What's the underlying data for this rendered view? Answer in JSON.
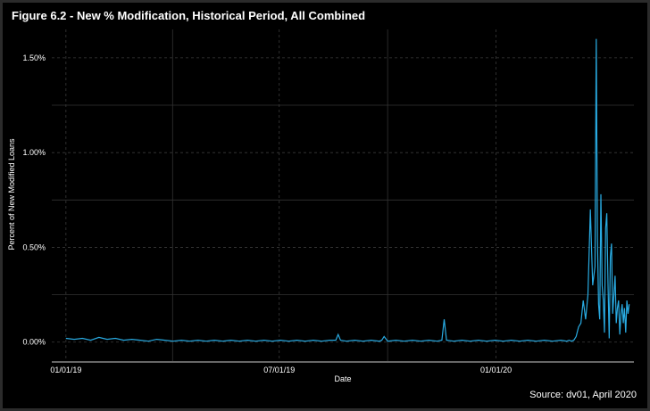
{
  "chart_data": {
    "type": "line",
    "title": "Figure 6.2 - New % Modification, Historical Period, All Combined",
    "xlabel": "Date",
    "ylabel": "Percent of New Modified Loans",
    "source": "Source: dv01, April 2020",
    "x_tick_labels": [
      "01/01/19",
      "07/01/19",
      "01/01/20"
    ],
    "x_ticks": [
      "2019-01-01",
      "2019-07-01",
      "2020-01-01"
    ],
    "y_tick_labels": [
      "0.00%",
      "0.50%",
      "1.00%",
      "1.50%"
    ],
    "y_ticks": [
      0.0,
      0.5,
      1.0,
      1.5
    ],
    "xlim": [
      "2018-12-20",
      "2020-04-27"
    ],
    "ylim": [
      -0.1,
      1.65
    ],
    "line_color": "#29abe2",
    "grid": true,
    "series": [
      {
        "x": [
          "2019-01-01",
          "2019-01-08",
          "2019-01-15",
          "2019-01-22",
          "2019-01-29",
          "2019-02-05",
          "2019-02-12",
          "2019-02-19",
          "2019-02-26",
          "2019-03-05",
          "2019-03-12",
          "2019-03-19",
          "2019-03-26",
          "2019-04-02",
          "2019-04-09",
          "2019-04-16",
          "2019-04-23",
          "2019-04-30",
          "2019-05-07",
          "2019-05-14",
          "2019-05-21",
          "2019-05-28",
          "2019-06-04",
          "2019-06-11",
          "2019-06-18",
          "2019-06-25",
          "2019-07-02",
          "2019-07-09",
          "2019-07-16",
          "2019-07-23",
          "2019-07-30",
          "2019-08-06",
          "2019-08-13",
          "2019-08-18",
          "2019-08-20",
          "2019-08-22",
          "2019-08-27",
          "2019-09-03",
          "2019-09-10",
          "2019-09-17",
          "2019-09-24",
          "2019-09-26",
          "2019-09-28",
          "2019-10-01",
          "2019-10-08",
          "2019-10-15",
          "2019-10-22",
          "2019-10-29",
          "2019-11-05",
          "2019-11-12",
          "2019-11-16",
          "2019-11-18",
          "2019-11-20",
          "2019-11-26",
          "2019-12-03",
          "2019-12-10",
          "2019-12-17",
          "2019-12-24",
          "2019-12-31",
          "2020-01-07",
          "2020-01-14",
          "2020-01-21",
          "2020-01-28",
          "2020-02-04",
          "2020-02-11",
          "2020-02-18",
          "2020-02-25",
          "2020-03-01",
          "2020-03-03",
          "2020-03-05",
          "2020-03-07",
          "2020-03-09",
          "2020-03-11",
          "2020-03-13",
          "2020-03-15",
          "2020-03-17",
          "2020-03-19",
          "2020-03-21",
          "2020-03-23",
          "2020-03-25",
          "2020-03-26",
          "2020-03-27",
          "2020-03-28",
          "2020-03-29",
          "2020-03-30",
          "2020-03-31",
          "2020-04-01",
          "2020-04-02",
          "2020-04-03",
          "2020-04-04",
          "2020-04-05",
          "2020-04-06",
          "2020-04-07",
          "2020-04-08",
          "2020-04-09",
          "2020-04-10",
          "2020-04-11",
          "2020-04-12",
          "2020-04-13",
          "2020-04-14",
          "2020-04-15",
          "2020-04-16",
          "2020-04-17",
          "2020-04-18",
          "2020-04-19",
          "2020-04-20",
          "2020-04-21",
          "2020-04-22",
          "2020-04-23"
        ],
        "values": [
          0.02,
          0.015,
          0.02,
          0.01,
          0.025,
          0.015,
          0.02,
          0.01,
          0.015,
          0.01,
          0.005,
          0.015,
          0.01,
          0.005,
          0.01,
          0.005,
          0.01,
          0.005,
          0.01,
          0.005,
          0.01,
          0.005,
          0.01,
          0.005,
          0.01,
          0.005,
          0.01,
          0.005,
          0.01,
          0.005,
          0.01,
          0.005,
          0.01,
          0.01,
          0.04,
          0.01,
          0.005,
          0.01,
          0.005,
          0.01,
          0.005,
          0.01,
          0.03,
          0.005,
          0.01,
          0.005,
          0.01,
          0.005,
          0.01,
          0.005,
          0.01,
          0.12,
          0.01,
          0.005,
          0.01,
          0.005,
          0.01,
          0.005,
          0.01,
          0.005,
          0.01,
          0.005,
          0.01,
          0.005,
          0.01,
          0.005,
          0.01,
          0.005,
          0.01,
          0.005,
          0.01,
          0.03,
          0.08,
          0.1,
          0.22,
          0.12,
          0.25,
          0.7,
          0.3,
          0.4,
          1.6,
          0.55,
          0.2,
          0.12,
          0.78,
          0.3,
          0.22,
          0.05,
          0.6,
          0.68,
          0.3,
          0.02,
          0.45,
          0.52,
          0.15,
          0.25,
          0.35,
          0.1,
          0.18,
          0.22,
          0.04,
          0.15,
          0.2,
          0.1,
          0.18,
          0.05,
          0.22,
          0.15,
          0.2
        ]
      }
    ]
  }
}
